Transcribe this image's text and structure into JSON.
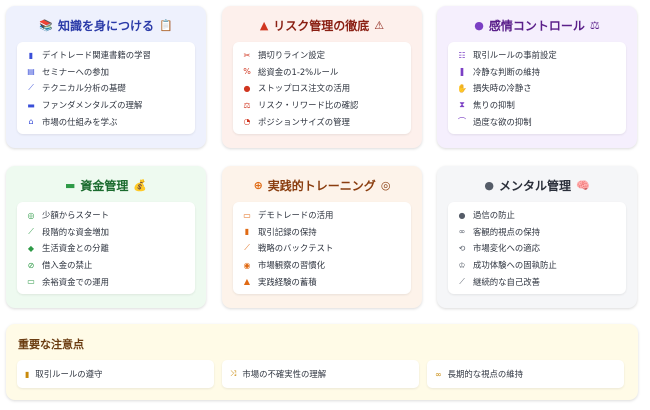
{
  "cards": [
    {
      "title": "知識を身につける",
      "title_icon": "📚",
      "title_emoji": "📋",
      "bg": "#eef1fd",
      "title_color": "#2a3aa8",
      "icon_color": "#3a4fd8",
      "items": [
        {
          "icon": "book-icon",
          "glyph": "▮",
          "label": "デイトレード関連書籍の学習"
        },
        {
          "icon": "chalkboard-icon",
          "glyph": "▤",
          "label": "セミナーへの参加"
        },
        {
          "icon": "chart-line-icon",
          "glyph": "⟋",
          "label": "テクニカル分析の基礎"
        },
        {
          "icon": "newspaper-icon",
          "glyph": "▬",
          "label": "ファンダメンタルズの理解"
        },
        {
          "icon": "bank-icon",
          "glyph": "⌂",
          "label": "市場の仕組みを学ぶ"
        }
      ]
    },
    {
      "title": "リスク管理の徹底",
      "title_icon": "▲",
      "title_emoji": "⚠",
      "bg": "#fdf0ec",
      "title_color": "#8a1f13",
      "icon_color": "#d0351f",
      "items": [
        {
          "icon": "scissors-icon",
          "glyph": "✂",
          "label": "損切りライン設定"
        },
        {
          "icon": "percent-icon",
          "glyph": "%",
          "label": "総資金の1-2%ルール"
        },
        {
          "icon": "stop-circle-icon",
          "glyph": "●",
          "label": "ストップロス注文の活用"
        },
        {
          "icon": "balance-scale-icon",
          "glyph": "⚖",
          "label": "リスク・リワード比の確認"
        },
        {
          "icon": "pie-chart-icon",
          "glyph": "◔",
          "label": "ポジションサイズの管理"
        }
      ]
    },
    {
      "title": "感情コントロール",
      "title_icon": "●",
      "title_emoji": "⚖",
      "bg": "#f5effd",
      "title_color": "#5a1f8a",
      "icon_color": "#7b3fc4",
      "items": [
        {
          "icon": "list-check-icon",
          "glyph": "☷",
          "label": "取引ルールの事前設定"
        },
        {
          "icon": "thermometer-icon",
          "glyph": "❚",
          "label": "冷静な判断の維持"
        },
        {
          "icon": "hand-icon",
          "glyph": "✋",
          "label": "損失時の冷静さ"
        },
        {
          "icon": "hourglass-icon",
          "glyph": "⧗",
          "label": "焦りの抑制"
        },
        {
          "icon": "hand-holding-icon",
          "glyph": "⌒",
          "label": "過度な欲の抑制"
        }
      ]
    },
    {
      "title": "資金管理",
      "title_icon": "▬",
      "title_emoji": "💰",
      "bg": "#eefaf0",
      "title_color": "#1a6b2e",
      "icon_color": "#2e9a47",
      "items": [
        {
          "icon": "coins-icon",
          "glyph": "◎",
          "label": "少額からスタート"
        },
        {
          "icon": "stairs-icon",
          "glyph": "⟋",
          "label": "段階的な資金増加"
        },
        {
          "icon": "piggy-bank-icon",
          "glyph": "◆",
          "label": "生活資金との分離"
        },
        {
          "icon": "ban-icon",
          "glyph": "⊘",
          "label": "借入金の禁止"
        },
        {
          "icon": "money-bill-icon",
          "glyph": "▭",
          "label": "余裕資金での運用"
        }
      ]
    },
    {
      "title": "実践的トレーニング",
      "title_icon": "⊕",
      "title_emoji": "◎",
      "bg": "#fdf3ea",
      "title_color": "#8a3d0f",
      "icon_color": "#e06a14",
      "items": [
        {
          "icon": "desktop-icon",
          "glyph": "▭",
          "label": "デモトレードの活用"
        },
        {
          "icon": "book-icon",
          "glyph": "▮",
          "label": "取引記録の保持"
        },
        {
          "icon": "chart-area-icon",
          "glyph": "⟋",
          "label": "戦略のバックテスト"
        },
        {
          "icon": "eye-icon",
          "glyph": "◉",
          "label": "市場観察の習慣化"
        },
        {
          "icon": "graduation-cap-icon",
          "glyph": "▲",
          "label": "実践経験の蓄積"
        }
      ]
    },
    {
      "title": "メンタル管理",
      "title_icon": "●",
      "title_emoji": "🧠",
      "bg": "#f5f6f8",
      "title_color": "#2a2f3a",
      "icon_color": "#555c68",
      "items": [
        {
          "icon": "info-circle-icon",
          "glyph": "●",
          "label": "過信の防止"
        },
        {
          "icon": "glasses-icon",
          "glyph": "∞",
          "label": "客観的視点の保持"
        },
        {
          "icon": "sync-icon",
          "glyph": "⟲",
          "label": "市場変化への適応"
        },
        {
          "icon": "trophy-icon",
          "glyph": "♔",
          "label": "成功体験への固執防止"
        },
        {
          "icon": "chart-line-icon",
          "glyph": "⟋",
          "label": "継続的な自己改善"
        }
      ]
    }
  ],
  "notes": {
    "title": "重要な注意点",
    "icon_color": "#c98a0b",
    "items": [
      {
        "icon": "clipboard-icon",
        "glyph": "▮",
        "label": "取引ルールの遵守"
      },
      {
        "icon": "random-icon",
        "glyph": "⤨",
        "label": "市場の不確実性の理解"
      },
      {
        "icon": "binoculars-icon",
        "glyph": "∞",
        "label": "長期的な視点の維持"
      }
    ]
  }
}
